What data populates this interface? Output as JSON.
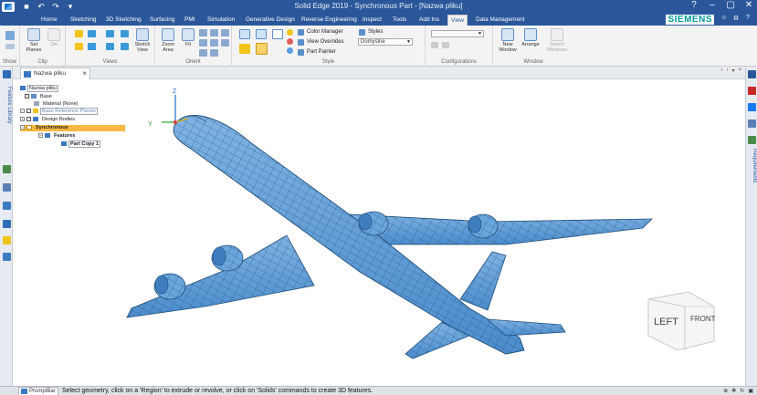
{
  "window": {
    "title": "Solid Edge 2019 - Synchronous Part - [Nazwa pliku]",
    "controls": [
      "?",
      "–",
      "▢",
      "✕"
    ]
  },
  "brand": "SIEMENS",
  "tabs": [
    {
      "label": "Home"
    },
    {
      "label": "Sketching"
    },
    {
      "label": "3D Sketching"
    },
    {
      "label": "Surfacing"
    },
    {
      "label": "PMI"
    },
    {
      "label": "Simulation"
    },
    {
      "label": "Generative Design"
    },
    {
      "label": "Reverse Engineering"
    },
    {
      "label": "Inspect"
    },
    {
      "label": "Tools"
    },
    {
      "label": "Add Ins"
    },
    {
      "label": "View"
    },
    {
      "label": "Data Management"
    }
  ],
  "active_tab": "View",
  "ribbon": {
    "groups": {
      "show": "Show",
      "clip": "Clip",
      "views": "Views",
      "orient": "Orient",
      "style": "Style",
      "configurations": "Configurations",
      "window": "Window"
    },
    "set_planes": "Set Planes",
    "on": "On",
    "sketch_view": "Sketch View",
    "zoom_area": "Zoom Area",
    "fit": "Fit",
    "color_manager": "Color Manager",
    "view_overrides": "View Overrides",
    "part_painter": "Part Painter",
    "styles": "Styles",
    "style_value": "Domyślne",
    "new_window": "New Window",
    "arrange": "Arrange",
    "switch_windows": "Switch Windows"
  },
  "document_tab": "Nazwa pliku",
  "left_panel_label": "Feature Library",
  "right_panel_label": "Requirements",
  "tree": {
    "root": "Nazwa pliku",
    "base": "Base",
    "material": "Material (None)",
    "ref_planes": "Base Reference Planes",
    "design_bodies": "Design Bodies",
    "synchronous": "Synchronous",
    "features": "Features",
    "part_copy": "Part Copy 1"
  },
  "triad": {
    "z": "Z",
    "y": "Y"
  },
  "viewcube": {
    "left": "LEFT",
    "front": "FRONT"
  },
  "promptbar": {
    "tab": "PromptBar",
    "message": "Select geometry, click on a 'Region' to extrude or revolve, or click on 'Solids' commands to create 3D features."
  },
  "colors": {
    "titlebar": "#2b579a",
    "model_fill": "#5b9bd5",
    "model_edge": "#1f4e79",
    "synchronous_highlight": "#f7b843",
    "brand": "#009999"
  }
}
